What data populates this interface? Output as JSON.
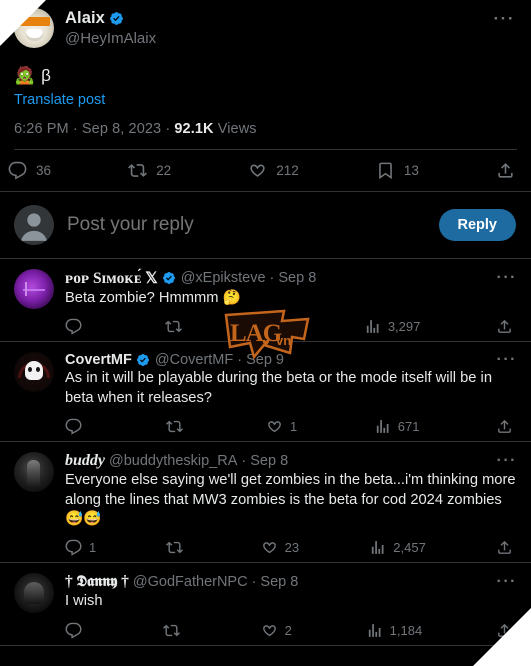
{
  "main_post": {
    "display_name": "Alaix",
    "handle": "@HeyImAlaix",
    "verified": true,
    "body_emoji": "🧟",
    "body_text": "β",
    "translate_label": "Translate post",
    "timestamp": "6:26 PM · Sep 8, 2023 · ",
    "views_count": "92.1K",
    "views_label": " Views",
    "more_icon": "···",
    "engagement": {
      "replies": "36",
      "reposts": "22",
      "likes": "212",
      "bookmarks": "13",
      "share_icon": "share-icon"
    }
  },
  "composer": {
    "placeholder": "Post your reply",
    "reply_button": "Reply",
    "avatar_icon": "default-avatar-icon"
  },
  "replies": [
    {
      "display_name": "ᴘᴏᴘ Sɪᴍᴏᴋᴇ́ 𝕏",
      "verified": true,
      "handle": "@xEpiksteve",
      "separator": "·",
      "date": "Sep 8",
      "text": "Beta zombie? Hmmmm 🤔",
      "more_icon": "···",
      "replies": "",
      "reposts": "",
      "likes": "",
      "views": "3,297",
      "avatar_style": "rav-pop",
      "name_style": "serif"
    },
    {
      "display_name": "CovertMF",
      "verified": true,
      "handle": "@CovertMF",
      "separator": "·",
      "date": "Sep 9",
      "text": "As in it will be playable during the beta or the mode itself will be in beta when it releases?",
      "more_icon": "···",
      "replies": "",
      "reposts": "",
      "likes": "1",
      "views": "671",
      "avatar_style": "rav-skull",
      "name_style": ""
    },
    {
      "display_name": "buddy",
      "verified": false,
      "handle": "@buddytheskip_RA",
      "separator": "·",
      "date": "Sep 8",
      "text": "Everyone else saying we'll get zombies in the beta...i'm thinking more along the lines that MW3 zombies is the beta for cod 2024 zombies😅😅",
      "more_icon": "···",
      "replies": "1",
      "reposts": "",
      "likes": "23",
      "views": "2,457",
      "avatar_style": "rav-dark1",
      "name_style": "italic"
    },
    {
      "display_name": "† 𝕯𝖆𝖓𝖓𝖞 †",
      "verified": false,
      "handle": "@GodFatherNPC",
      "separator": "·",
      "date": "Sep 8",
      "text": "I wish",
      "more_icon": "···",
      "replies": "",
      "reposts": "",
      "likes": "2",
      "views": "1,184",
      "avatar_style": "rav-dark2",
      "name_style": "serif"
    }
  ],
  "watermark": {
    "text_main": "LAG",
    "text_sub": "vn",
    "heart": "♥",
    "color": "#c4651c"
  },
  "colors": {
    "background": "#000000",
    "text_primary": "#e7e9ea",
    "text_secondary": "#71767b",
    "link": "#1d9bf0",
    "verified_badge": "#1d9bf0",
    "reply_button": "#1d6ba0",
    "divider": "#2f3336"
  }
}
